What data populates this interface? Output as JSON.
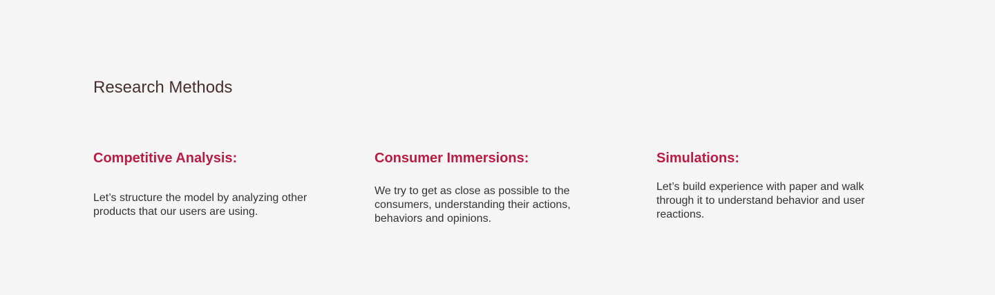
{
  "section": {
    "title": "Research Methods"
  },
  "methods": [
    {
      "title": "Competitive Analysis:",
      "description": "Let’s structure the model by analyzing other products that our users are using."
    },
    {
      "title": "Consumer Immersions:",
      "description": "We try to get as close as possible to the consumers, understanding their actions, behaviors and opinions."
    },
    {
      "title": "Simulations:",
      "description": "Let’s build experience with paper and walk through it to understand behavior and user reactions."
    }
  ],
  "colors": {
    "background": "#f5f5f5",
    "heading": "#46302f",
    "accent": "#bb1c44",
    "body_text": "#333333"
  }
}
